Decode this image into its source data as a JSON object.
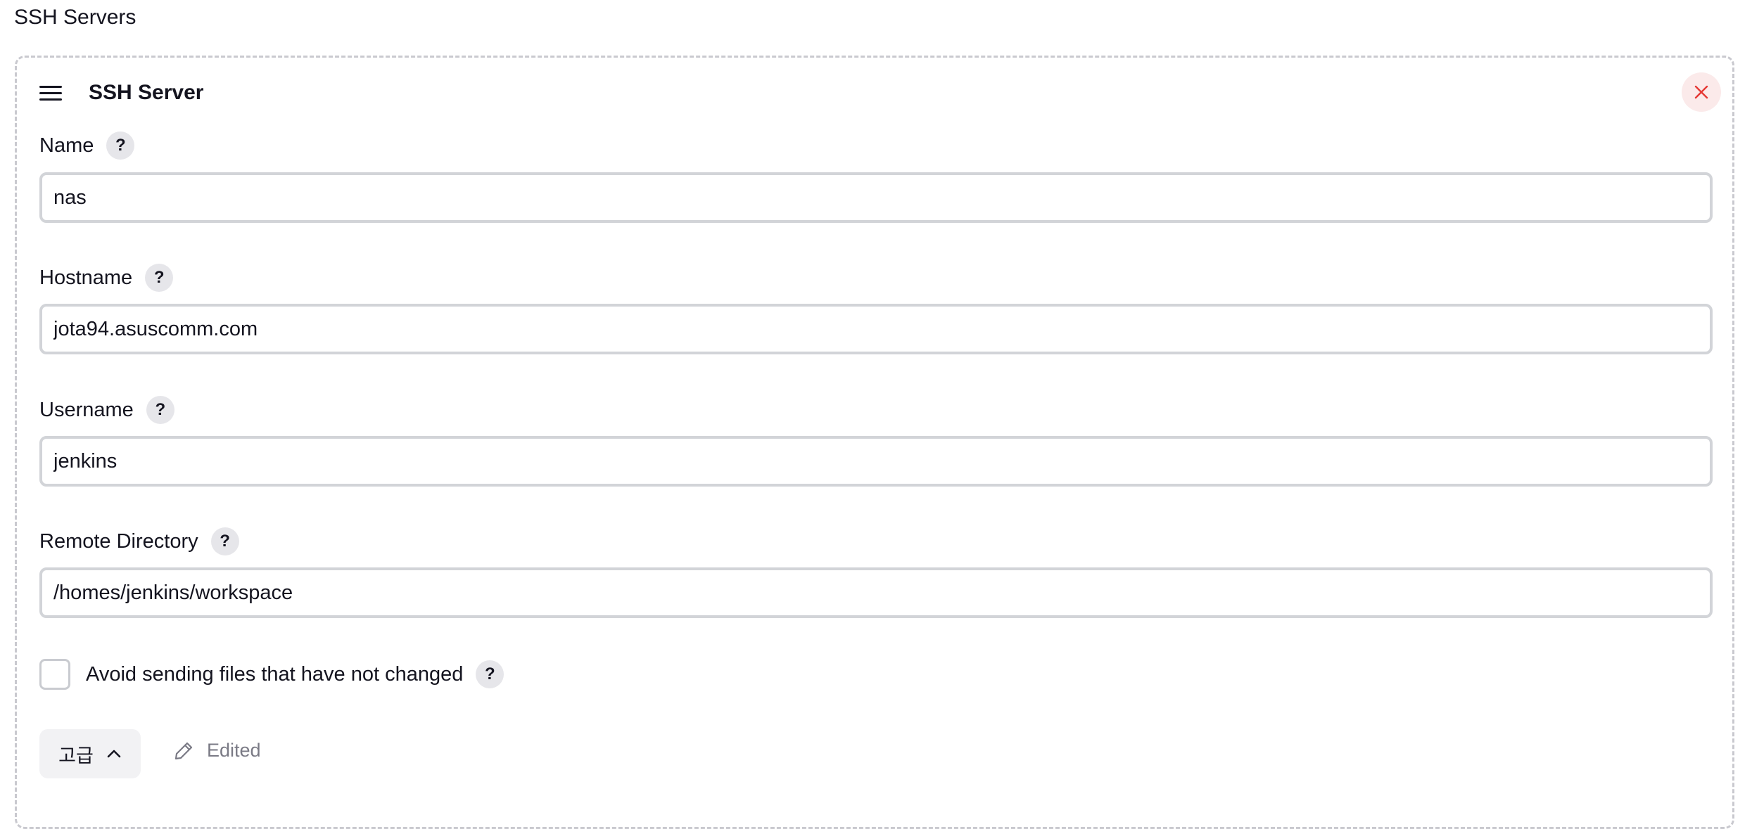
{
  "section": {
    "title": "SSH Servers"
  },
  "server": {
    "title": "SSH Server",
    "fields": {
      "name": {
        "label": "Name",
        "value": "nas"
      },
      "hostname": {
        "label": "Hostname",
        "value": "jota94.asuscomm.com"
      },
      "username": {
        "label": "Username",
        "value": "jenkins"
      },
      "remote_directory": {
        "label": "Remote Directory",
        "value": "/homes/jenkins/workspace"
      }
    },
    "avoid_sending": {
      "label": "Avoid sending files that have not changed",
      "checked": false
    },
    "help_text": "?",
    "advanced_label": "고급",
    "edited_label": "Edited"
  },
  "icons": {
    "drag": "drag-handle-icon",
    "close": "close-icon",
    "help": "help-icon",
    "chevron": "chevron-up-icon",
    "pencil": "pencil-icon"
  },
  "colors": {
    "close_bg": "#fbeaea",
    "close_icon": "#e53935",
    "help_bg": "#e6e6ea",
    "input_border": "#d2d4d8",
    "muted": "#7a7a85"
  }
}
